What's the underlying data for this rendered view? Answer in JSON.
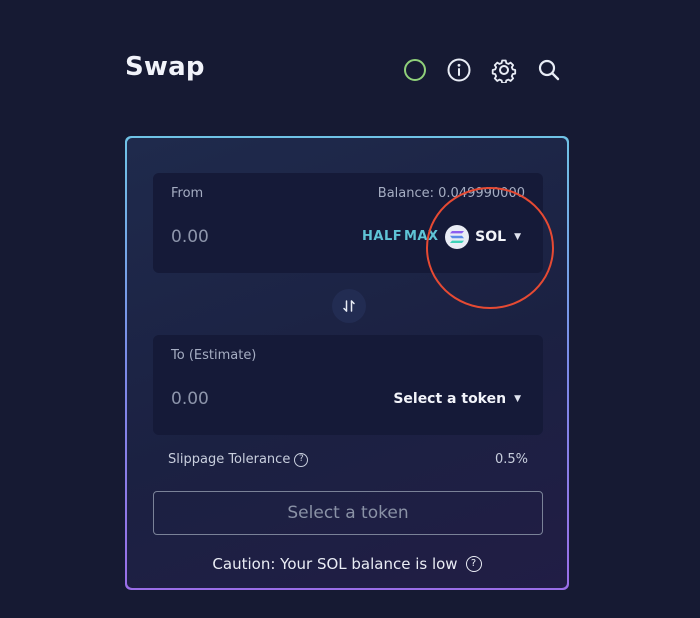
{
  "header": {
    "title": "Swap",
    "icons": [
      "status-ring-icon",
      "info-icon",
      "gear-icon",
      "search-icon"
    ],
    "status_color": "#8fd07a"
  },
  "from_panel": {
    "label": "From",
    "balance": "Balance: 0.049990000",
    "amount_placeholder": "0.00",
    "half_label": "HALF",
    "max_label": "MAX",
    "token": "SOL"
  },
  "to_panel": {
    "label": "To (Estimate)",
    "amount_placeholder": "0.00",
    "token_select_label": "Select a token"
  },
  "slippage": {
    "label": "Slippage Tolerance",
    "value": "0.5%"
  },
  "action_button": {
    "label": "Select a token"
  },
  "caution": {
    "text": "Caution: Your SOL balance is low"
  },
  "colors": {
    "background": "#161a33",
    "accent": "#5fc4d6",
    "highlight_circle": "#e64a33"
  }
}
